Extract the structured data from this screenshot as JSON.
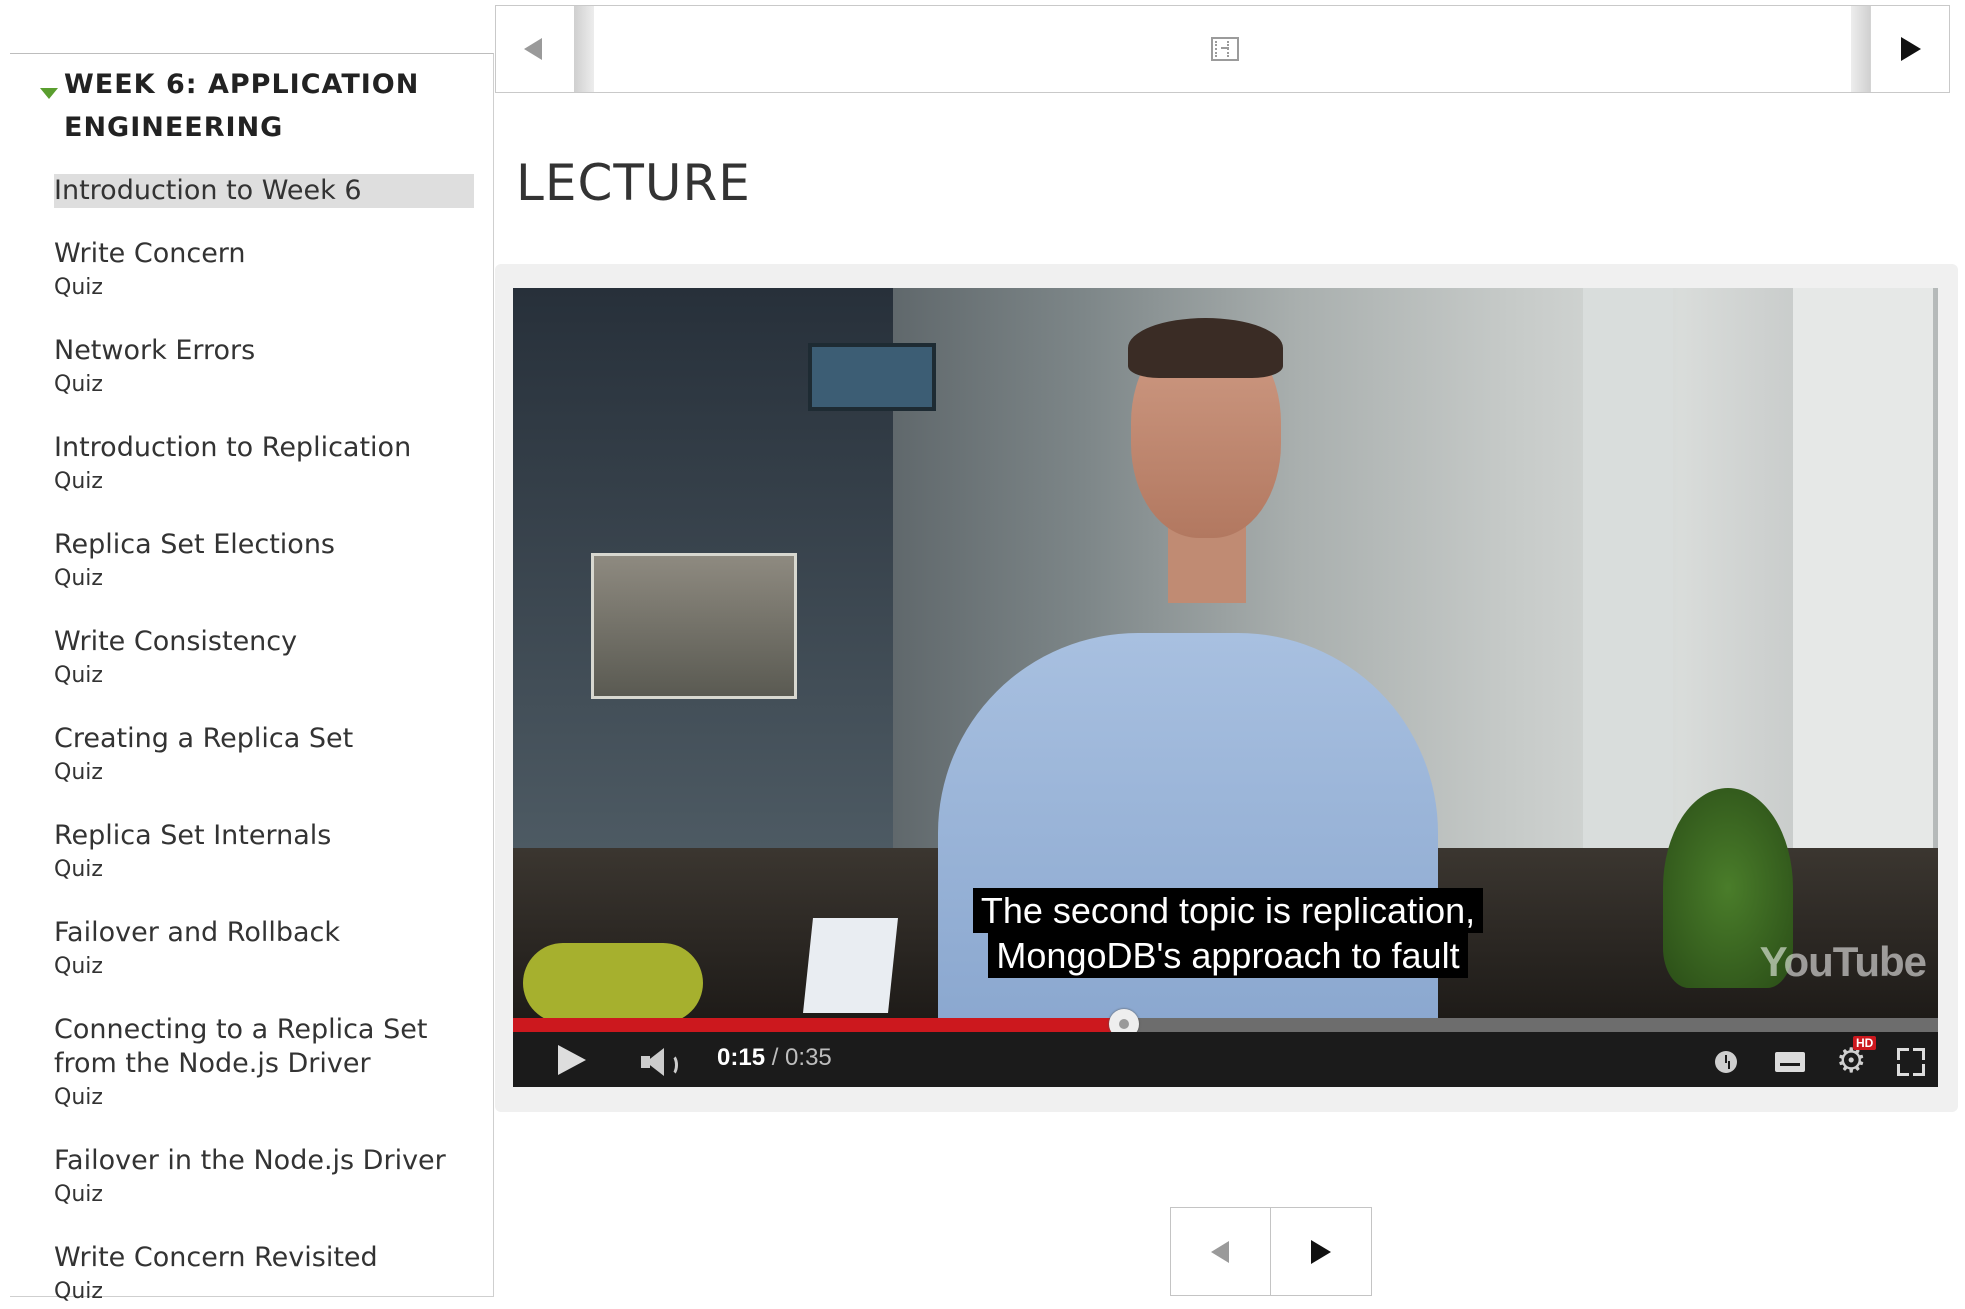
{
  "sidebar": {
    "week_title": "WEEK 6: APPLICATION ENGINEERING",
    "items": [
      {
        "title": "Introduction to Week 6",
        "sub": "",
        "active": true
      },
      {
        "title": "Write Concern",
        "sub": "Quiz"
      },
      {
        "title": "Network Errors",
        "sub": "Quiz"
      },
      {
        "title": "Introduction to Replication",
        "sub": "Quiz"
      },
      {
        "title": "Replica Set Elections",
        "sub": "Quiz"
      },
      {
        "title": "Write Consistency",
        "sub": "Quiz"
      },
      {
        "title": "Creating a Replica Set",
        "sub": "Quiz"
      },
      {
        "title": "Replica Set Internals",
        "sub": "Quiz"
      },
      {
        "title": "Failover and Rollback",
        "sub": "Quiz"
      },
      {
        "title": "Connecting to a Replica Set from the Node.js Driver",
        "sub": "Quiz"
      },
      {
        "title": "Failover in the Node.js Driver",
        "sub": "Quiz"
      },
      {
        "title": "Write Concern Revisited",
        "sub": "Quiz"
      }
    ]
  },
  "top_nav": {
    "prev_icon": "triangle-left-icon",
    "center_icon": "film-icon",
    "next_icon": "triangle-right-icon"
  },
  "main": {
    "heading": "LECTURE"
  },
  "video": {
    "caption_line1": "The second topic is replication,",
    "caption_line2": "MongoDB's approach to fault",
    "current_time": "0:15",
    "total_time": "/ 0:35",
    "progress": 0.4286,
    "logo": "YouTube",
    "hd_badge": "HD",
    "accent_color": "#cc181e"
  },
  "bottom_nav": {
    "prev_icon": "triangle-left-icon",
    "next_icon": "triangle-right-icon"
  }
}
